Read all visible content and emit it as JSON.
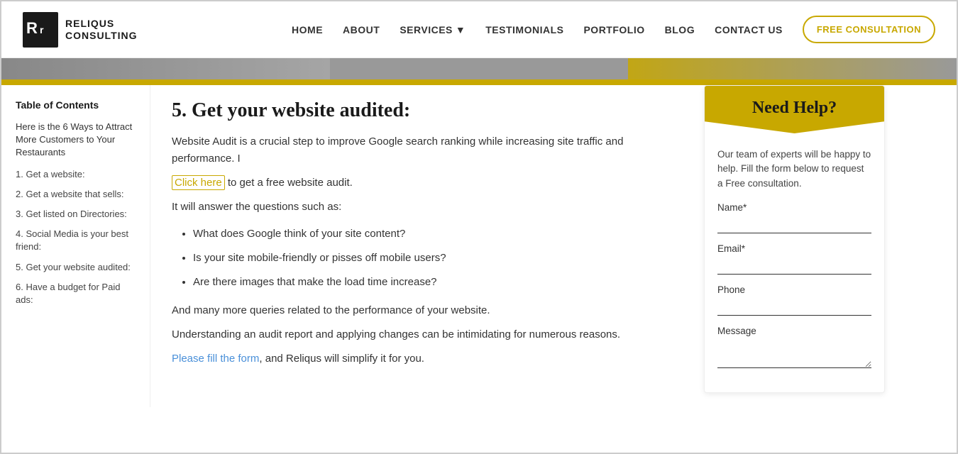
{
  "header": {
    "logo_line1": "RELIQUS",
    "logo_line2": "CONSULTING",
    "nav_items": [
      {
        "label": "HOME",
        "id": "home"
      },
      {
        "label": "ABOUT",
        "id": "about"
      },
      {
        "label": "SERVICES",
        "id": "services",
        "has_dropdown": true
      },
      {
        "label": "TESTIMONIALS",
        "id": "testimonials"
      },
      {
        "label": "PORTFOLIO",
        "id": "portfolio"
      },
      {
        "label": "BLOG",
        "id": "blog"
      },
      {
        "label": "CONTACT US",
        "id": "contact"
      }
    ],
    "cta_label": "FREE CONSULTATION"
  },
  "sidebar": {
    "toc_title": "Table of Contents",
    "toc_intro": "Here is the 6 Ways to Attract More Customers to Your Restaurants",
    "toc_items": [
      {
        "label": "1. Get a website:",
        "id": "toc-1"
      },
      {
        "label": "2. Get a website that sells:",
        "id": "toc-2"
      },
      {
        "label": "3. Get listed on Directories:",
        "id": "toc-3"
      },
      {
        "label": "4. Social Media is your best friend:",
        "id": "toc-4"
      },
      {
        "label": "5. Get your website audited:",
        "id": "toc-5"
      },
      {
        "label": "6. Have a budget for Paid ads:",
        "id": "toc-6"
      }
    ]
  },
  "content": {
    "section_number": "5.",
    "section_title": "Get your website audited:",
    "para1": "Website Audit is a crucial step to improve Google search ranking while increasing site traffic and performance. I",
    "click_here_text": "Click here",
    "click_here_suffix": " to get a free website audit.",
    "questions_intro": "It will answer the questions such as:",
    "bullets": [
      "What does Google think of your site content?",
      "Is your site mobile-friendly or pisses off mobile users?",
      "Are there images that make the load time increase?"
    ],
    "and_many_more": "And many more queries related to the performance of your website.",
    "understanding_para": "Understanding an audit report and applying changes can be intimidating for numerous reasons.",
    "please_text": "Please fill the form",
    "please_suffix": ", and Reliqus will simplify it for you."
  },
  "right_sidebar": {
    "need_help_title": "Need Help?",
    "description": "Our team of experts will be happy to help. Fill the form below to request a Free consultation.",
    "form": {
      "name_label": "Name*",
      "email_label": "Email*",
      "phone_label": "Phone",
      "message_label": "Message",
      "name_placeholder": "",
      "email_placeholder": "",
      "phone_placeholder": "",
      "message_placeholder": ""
    }
  }
}
